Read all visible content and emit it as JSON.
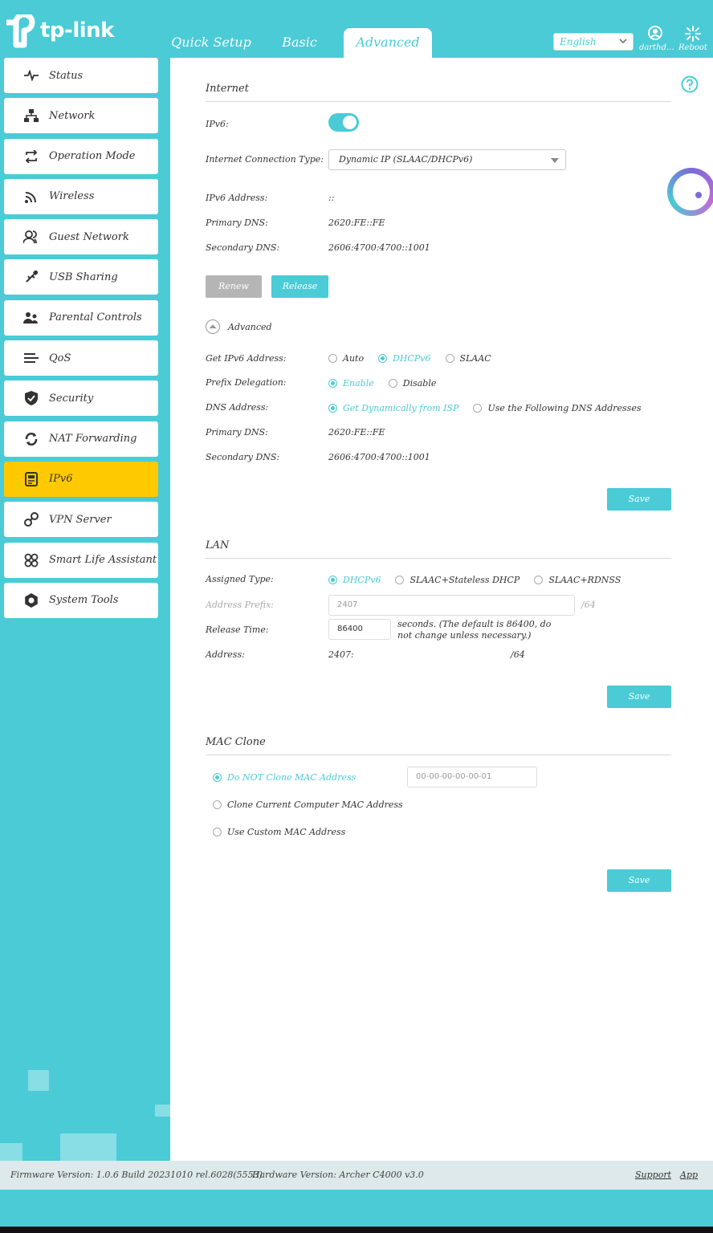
{
  "header": {
    "logo_text": "tp-link",
    "tabs": [
      {
        "label": "Quick Setup",
        "active": false
      },
      {
        "label": "Basic",
        "active": false
      },
      {
        "label": "Advanced",
        "active": true
      }
    ],
    "language": "English",
    "user_label": "darthd...",
    "reboot_label": "Reboot"
  },
  "sidebar": {
    "items": [
      {
        "label": "Status",
        "icon": "pulse-icon"
      },
      {
        "label": "Network",
        "icon": "network-icon"
      },
      {
        "label": "Operation Mode",
        "icon": "cycle-icon"
      },
      {
        "label": "Wireless",
        "icon": "wifi-icon"
      },
      {
        "label": "Guest Network",
        "icon": "guest-icon"
      },
      {
        "label": "USB Sharing",
        "icon": "usb-icon"
      },
      {
        "label": "Parental Controls",
        "icon": "family-icon"
      },
      {
        "label": "QoS",
        "icon": "qos-icon"
      },
      {
        "label": "Security",
        "icon": "shield-icon"
      },
      {
        "label": "NAT Forwarding",
        "icon": "nat-icon"
      },
      {
        "label": "IPv6",
        "icon": "ipv6-icon",
        "active": true
      },
      {
        "label": "VPN Server",
        "icon": "key-icon"
      },
      {
        "label": "Smart Life Assistant",
        "icon": "smart-icon"
      },
      {
        "label": "System Tools",
        "icon": "gear-icon"
      }
    ]
  },
  "internet": {
    "title": "Internet",
    "ipv6_label": "IPv6:",
    "ipv6_enabled": true,
    "conn_type_label": "Internet Connection Type:",
    "conn_type_value": "Dynamic IP (SLAAC/DHCPv6)",
    "address_label": "IPv6 Address:",
    "address_value": "::",
    "primary_dns_label": "Primary DNS:",
    "primary_dns_value": "2620:FE::FE",
    "secondary_dns_label": "Secondary DNS:",
    "secondary_dns_value": "2606:4700:4700::1001",
    "renew_label": "Renew",
    "release_label": "Release",
    "advanced_label": "Advanced",
    "get_addr_label": "Get IPv6 Address:",
    "get_addr_options": [
      "Auto",
      "DHCPv6",
      "SLAAC"
    ],
    "prefix_label": "Prefix Delegation:",
    "prefix_options": [
      "Enable",
      "Disable"
    ],
    "dns_addr_label": "DNS Address:",
    "dns_addr_options": [
      "Get Dynamically from ISP",
      "Use the Following DNS Addresses"
    ],
    "adv_primary_dns_label": "Primary DNS:",
    "adv_primary_dns_value": "2620:FE::FE",
    "adv_secondary_dns_label": "Secondary DNS:",
    "adv_secondary_dns_value": "2606:4700:4700::1001",
    "save_label": "Save"
  },
  "lan": {
    "title": "LAN",
    "assigned_type_label": "Assigned Type:",
    "assigned_type_options": [
      "DHCPv6",
      "SLAAC+Stateless DHCP",
      "SLAAC+RDNSS"
    ],
    "prefix_label": "Address Prefix:",
    "prefix_value": "2407",
    "prefix_suffix": "/64",
    "release_time_label": "Release Time:",
    "release_time_value": "86400",
    "release_note": "seconds. (The default is 86400, do not change unless necessary.)",
    "address_label": "Address:",
    "address_value": "2407:",
    "address_suffix": "/64",
    "save_label": "Save"
  },
  "mac_clone": {
    "title": "MAC Clone",
    "options": [
      "Do NOT Clone MAC Address",
      "Clone Current Computer MAC Address",
      "Use Custom MAC Address"
    ],
    "mac_placeholder": "00-00-00-00-00-01",
    "save_label": "Save"
  },
  "footer": {
    "firmware": "Firmware Version: 1.0.6 Build 20231010 rel.6028(5553)",
    "hardware": "Hardware Version: Archer C4000 v3.0",
    "support": "Support",
    "app": "App"
  }
}
